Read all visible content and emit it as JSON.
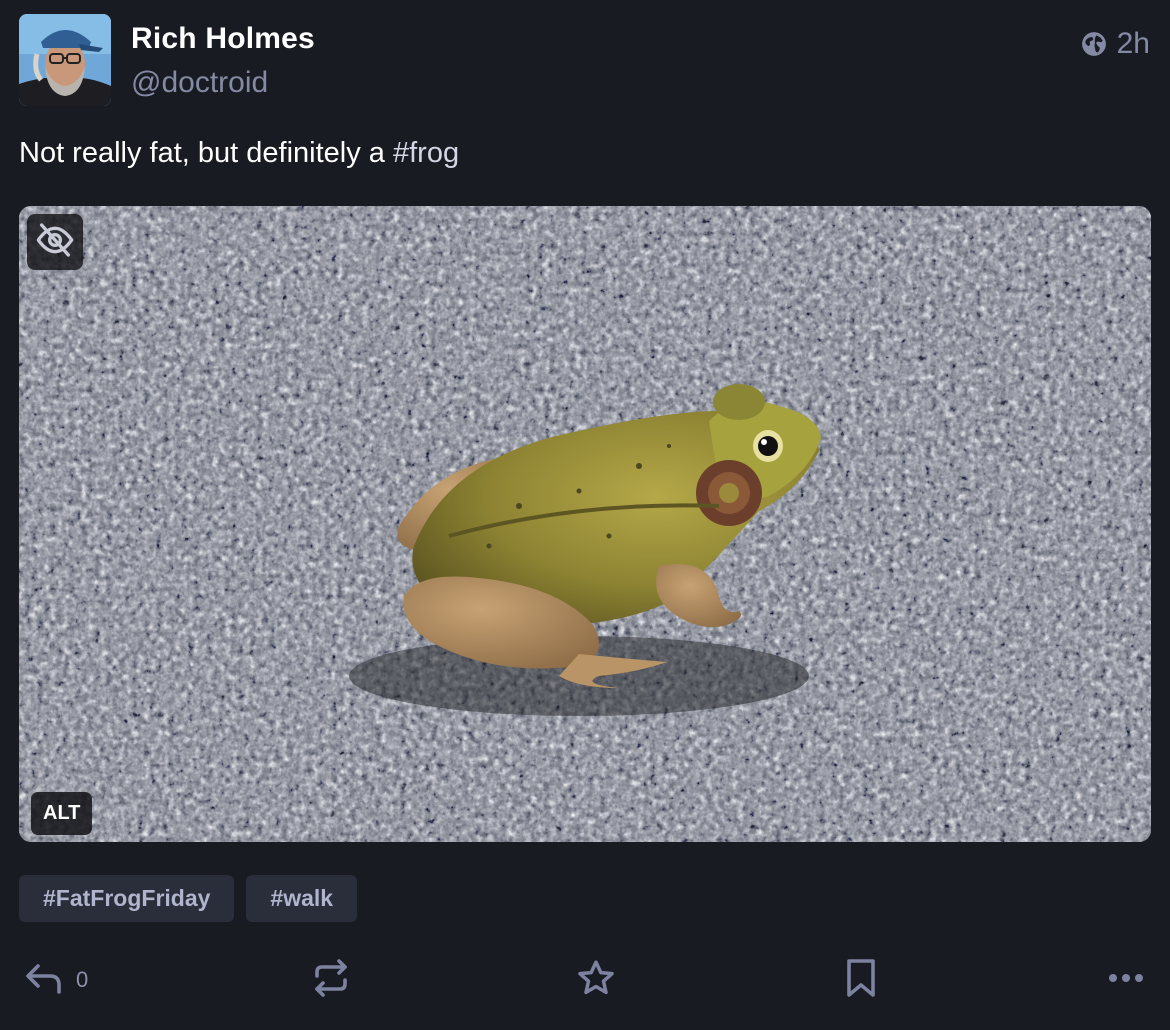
{
  "author": {
    "display_name": "Rich Holmes",
    "handle": "@doctroid"
  },
  "meta": {
    "visibility_icon": "globe-icon",
    "relative_time": "2h"
  },
  "content": {
    "text": "Not really fat, but definitely a ",
    "hashtag": "#frog"
  },
  "media": {
    "hide_icon": "eye-slash-icon",
    "alt_label": "ALT"
  },
  "hashtags": [
    "#FatFrogFriday",
    "#walk"
  ],
  "actions": {
    "reply_count": "0",
    "reply_icon": "reply-icon",
    "boost_icon": "boost-icon",
    "favourite_icon": "star-icon",
    "bookmark_icon": "bookmark-icon",
    "more_icon": "ellipsis-icon"
  },
  "colors": {
    "background": "#191b22",
    "muted_text": "#858aa4",
    "pill_background": "#2a2d3a"
  }
}
